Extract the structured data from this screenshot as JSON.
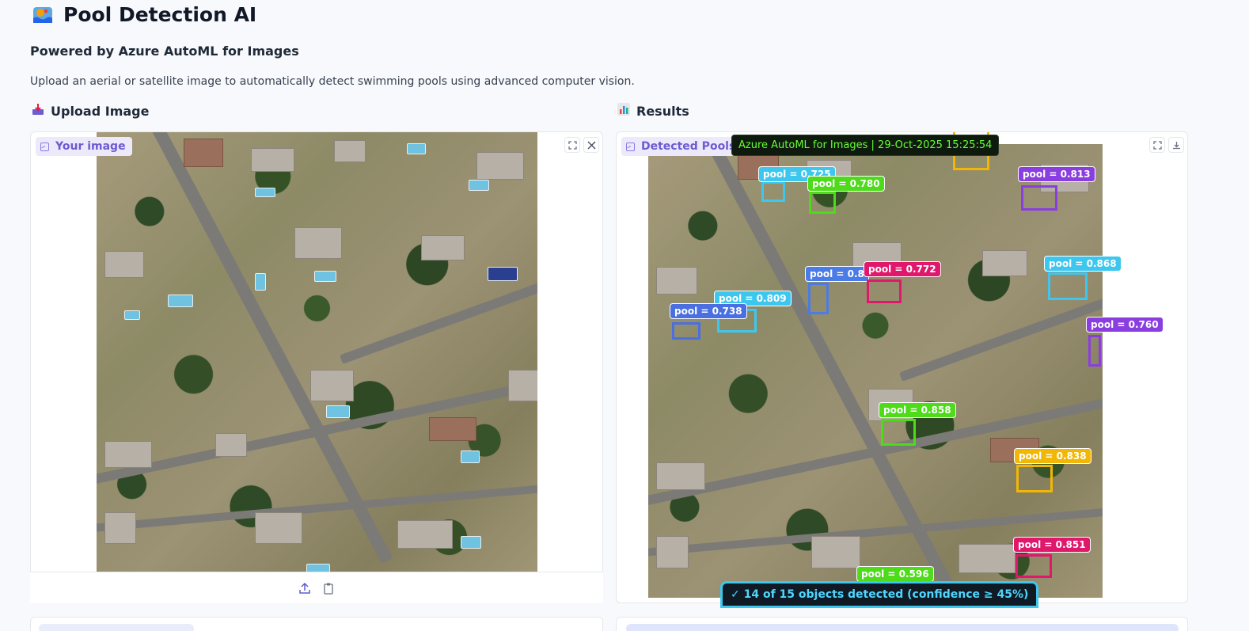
{
  "app": {
    "title": "Pool Detection AI",
    "icon": "pool-logo-icon",
    "subtitle": "Powered by Azure AutoML for Images",
    "description": "Upload an aerial or satellite image to automatically detect swimming pools using advanced computer vision."
  },
  "upload_section": {
    "heading": "Upload Image",
    "heading_icon": "inbox-tray-icon",
    "panel_label": "Your image",
    "fullscreen_icon": "fullscreen-icon",
    "close_icon": "close-icon",
    "upload_icon": "upload-icon",
    "clipboard_icon": "clipboard-icon"
  },
  "results_section": {
    "heading": "Results",
    "heading_icon": "bar-chart-icon",
    "panel_label": "Detected Pools",
    "fullscreen_icon": "fullscreen-icon",
    "download_icon": "download-icon",
    "banner": "Azure AutoML for Images  |  29-Oct-2025 15:25:54",
    "summary": "✓ 14 of 15 objects detected (confidence ≥ 45%)"
  },
  "detections": [
    {
      "label": "pool = 0.725",
      "color": "#3ec7ee"
    },
    {
      "label": "pool = 0.780",
      "color": "#4ddb1a"
    },
    {
      "label": "pool = 0.813",
      "color": "#8a3ee0"
    },
    {
      "label": "pool = 0.868",
      "color": "#3ec7ee"
    },
    {
      "label": "pool = 0.8",
      "color": "#4a7be6"
    },
    {
      "label": "pool = 0.772",
      "color": "#e0186c"
    },
    {
      "label": "pool = 0.809",
      "color": "#3ec7ee"
    },
    {
      "label": "pool = 0.738",
      "color": "#4a6fe0"
    },
    {
      "label": "pool = 0.760",
      "color": "#8a3ee0"
    },
    {
      "label": "pool = 0.858",
      "color": "#4ddb1a"
    },
    {
      "label": "pool = 0.838",
      "color": "#f2b705"
    },
    {
      "label": "pool = 0.851",
      "color": "#e0186c"
    },
    {
      "label": "pool = 0.596",
      "color": "#4ddb1a"
    }
  ],
  "colors": {
    "accent": "#6d5bd0",
    "banner_text": "#66ff33",
    "summary_text": "#4fd6ff"
  }
}
